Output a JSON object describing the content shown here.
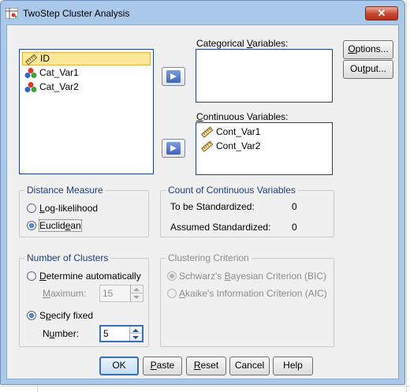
{
  "window": {
    "title": "TwoStep Cluster Analysis",
    "close_glyph": "✕"
  },
  "source_list": {
    "items": [
      {
        "label": "ID",
        "icon": "scale-icon",
        "selected": true
      },
      {
        "label": "Cat_Var1",
        "icon": "nominal-icon",
        "selected": false
      },
      {
        "label": "Cat_Var2",
        "icon": "nominal-icon",
        "selected": false
      }
    ]
  },
  "categorical": {
    "label_pre": "Categorical ",
    "label_u": "V",
    "label_post": "ariables:",
    "items": []
  },
  "continuous": {
    "label_pre": "",
    "label_u": "C",
    "label_post": "ontinuous Variables:",
    "items": [
      {
        "label": "Cont_Var1",
        "icon": "scale-icon"
      },
      {
        "label": "Cont_Var2",
        "icon": "scale-icon"
      }
    ]
  },
  "side_buttons": {
    "options_pre": "",
    "options_u": "O",
    "options_post": "ptions...",
    "output_pre": "Ou",
    "output_u": "t",
    "output_post": "put..."
  },
  "distance": {
    "title": "Distance Measure",
    "option1_pre": "",
    "option1_u": "L",
    "option1_post": "og-likelihood",
    "option1_selected": false,
    "option2_pre": "Euclid",
    "option2_u": "e",
    "option2_post": "an",
    "option2_selected": true
  },
  "count": {
    "title": "Count of Continuous Variables",
    "row1_label": "To be Standardized:",
    "row1_value": "0",
    "row2_label": "Assumed Standardized:",
    "row2_value": "0"
  },
  "clusters": {
    "title": "Number of Clusters",
    "auto_pre": "",
    "auto_u": "D",
    "auto_post": "etermine automatically",
    "auto_selected": false,
    "maximum_label_pre": "",
    "maximum_label_u": "M",
    "maximum_label_post": "aximum:",
    "maximum_value": "15",
    "fixed_pre": "S",
    "fixed_u": "p",
    "fixed_post": "ecify fixed",
    "fixed_selected": true,
    "number_label_pre": "N",
    "number_label_u": "u",
    "number_label_post": "mber:",
    "number_value": "5"
  },
  "criterion": {
    "title": "Clustering Criterion",
    "bic_pre": "Schwarz's ",
    "bic_u": "B",
    "bic_post": "ayesian Criterion (BIC)",
    "bic_selected": true,
    "aic_pre": "",
    "aic_u": "A",
    "aic_post": "kaike's Information Criterion (AIC)",
    "aic_selected": false
  },
  "footer": {
    "ok": "OK",
    "paste_pre": "",
    "paste_u": "P",
    "paste_post": "aste",
    "reset_pre": "",
    "reset_u": "R",
    "reset_post": "eset",
    "cancel": "Cancel",
    "help": "Help"
  },
  "colors": {
    "frame": "#a9c8ea",
    "client": "#f0f0f0",
    "selection": "#fde89a",
    "group_title": "#1c3d7a"
  }
}
